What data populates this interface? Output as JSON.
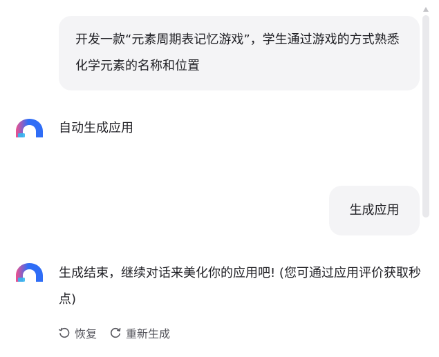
{
  "messages": {
    "user_prompt": "开发一款“元素周期表记忆游戏”，学生通过游戏的方式熟悉化学元素的名称和位置",
    "bot_reply_1": "自动生成应用",
    "user_reply": "生成应用",
    "bot_reply_2": "生成结束，继续对话来美化你的应用吧! (您可通过应用评价获取秒点)"
  },
  "actions": {
    "restore_label": "恢复",
    "regenerate_label": "重新生成"
  },
  "icons": {
    "avatar": "bot-avatar-icon",
    "restore": "undo-icon",
    "regenerate": "refresh-icon"
  },
  "colors": {
    "user_bubble": "#f4f4f6",
    "avatar_pink": "#f0508c",
    "avatar_blue": "#2f6df6",
    "avatar_teal": "#36b6f0"
  }
}
